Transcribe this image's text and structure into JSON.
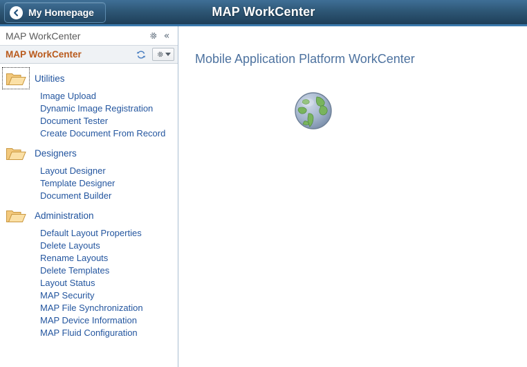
{
  "header": {
    "title": "MAP WorkCenter",
    "homepage_button": {
      "label": "My Homepage",
      "icon": "chevron-left-circle-icon"
    },
    "colors": {
      "bar_top": "#3f6f96",
      "bar_bottom": "#1e3e58",
      "accent_underline": "#3b79ad",
      "title_text": "#ffffff"
    }
  },
  "sidebar": {
    "pagelet_header": {
      "title": "MAP WorkCenter",
      "gear_icon": "gear-icon",
      "collapse_icon": "double-chevron-left-icon",
      "collapse_glyph": "«"
    },
    "group_header": {
      "title": "MAP WorkCenter",
      "refresh_icon": "refresh-icon",
      "actions_icon": "gear-dropdown-icon",
      "title_color": "#b95a1c",
      "background": "#eff2f5"
    },
    "groups": [
      {
        "label": "Utilities",
        "icon": "open-folder-icon",
        "focused": true,
        "items": [
          "Image Upload",
          "Dynamic Image Registration",
          "Document Tester",
          "Create Document From Record"
        ]
      },
      {
        "label": "Designers",
        "icon": "open-folder-icon",
        "focused": false,
        "items": [
          "Layout Designer",
          "Template Designer",
          "Document Builder"
        ]
      },
      {
        "label": "Administration",
        "icon": "open-folder-icon",
        "focused": false,
        "items": [
          "Default Layout Properties",
          "Delete Layouts",
          "Rename Layouts",
          "Delete Templates",
          "Layout Status",
          "MAP Security",
          "MAP File Synchronization",
          "MAP Device Information",
          "MAP Fluid Configuration"
        ]
      }
    ],
    "link_color": "#24569f"
  },
  "main": {
    "title": "Mobile Application Platform WorkCenter",
    "title_color": "#4d729f",
    "image": {
      "icon": "globe-icon",
      "ocean_color": "#9fb2cd",
      "land_color": "#7ab45e"
    }
  }
}
